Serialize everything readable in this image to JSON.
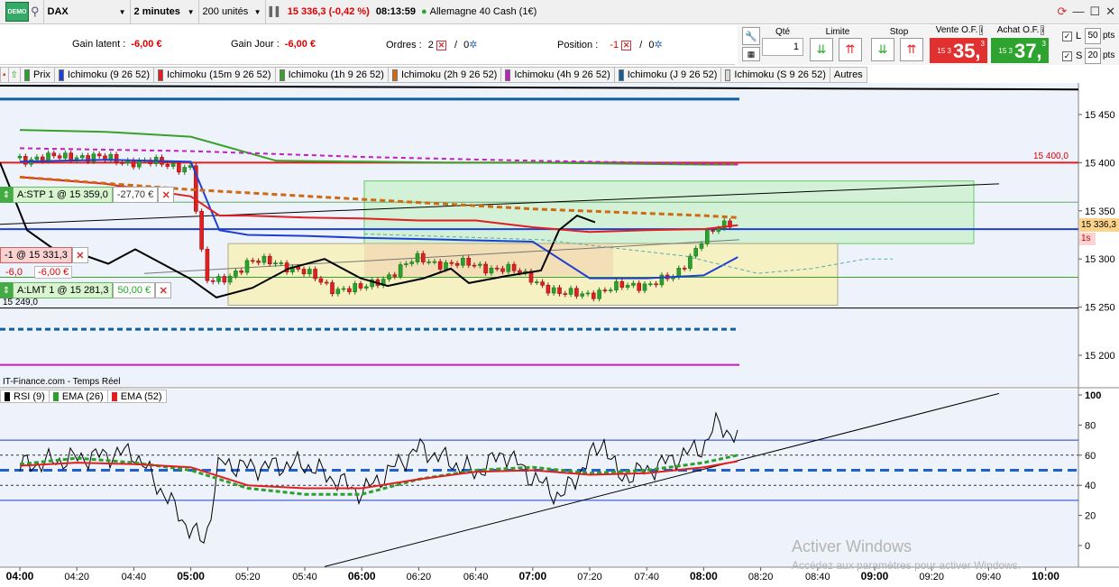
{
  "topbar": {
    "demo_label": "DEMO",
    "instrument": "DAX",
    "timeframe": "2 minutes",
    "units": "200 unités",
    "price": "15 336,3",
    "change": "(-0,42 %)",
    "time": "08:13:59",
    "market": "Allemagne 40 Cash (1€)"
  },
  "info": {
    "gain_latent_label": "Gain latent :",
    "gain_latent_value": "-6,00 €",
    "gain_jour_label": "Gain Jour :",
    "gain_jour_value": "-6,00 €",
    "ordres_label": "Ordres :",
    "ordres_a": "2",
    "ordres_b": "0",
    "position_label": "Position :",
    "position_a": "-1",
    "position_b": "0"
  },
  "order_panel": {
    "qte_label": "Qté",
    "qte_value": "1",
    "limite_label": "Limite",
    "stop_label": "Stop",
    "vente_label": "Vente O.F.",
    "achat_label": "Achat O.F.",
    "vente_prefix": "15 3",
    "vente_big": "35,",
    "vente_sup": "3",
    "achat_prefix": "15 3",
    "achat_big": "37,",
    "achat_sup": "3",
    "l_label": "L",
    "l_value": "50",
    "s_label": "S",
    "s_value": "20",
    "pts": "pts",
    "colors": {
      "sell": "#e03030",
      "buy": "#2fa32f"
    }
  },
  "legend": [
    {
      "label": "Prix",
      "color": "#2ca02c"
    },
    {
      "label": "Ichimoku (9 26 52)",
      "color": "#1f3fd0"
    },
    {
      "label": "Ichimoku (15m 9 26 52)",
      "color": "#e02020"
    },
    {
      "label": "Ichimoku (1h 9 26 52)",
      "color": "#3aa02a"
    },
    {
      "label": "Ichimoku (2h 9 26 52)",
      "color": "#d06a10"
    },
    {
      "label": "Ichimoku (4h 9 26 52)",
      "color": "#c020c0"
    },
    {
      "label": "Ichimoku (J 9 26 52)",
      "color": "#1060a0"
    },
    {
      "label": "Ichimoku (S 9 26 52)",
      "color": "#d8d8d8"
    },
    {
      "label": "Autres",
      "color": ""
    }
  ],
  "tags": {
    "stop": {
      "label": "A:STP  1 @ 15 359,0",
      "pnl": "-27,70 €"
    },
    "position": {
      "label": "-1 @ 15 331,3",
      "pnl_a": "-6,0",
      "pnl_b": "-6,00 €"
    },
    "limit": {
      "label": "A:LMT  1 @ 15 281,3",
      "pnl": "50,00 €"
    },
    "level_low": "15 249,0",
    "level_high": "15 400,0",
    "last_price": "15 336,3",
    "period": "1s"
  },
  "source": "IT-Finance.com - Temps Réel",
  "rsi_legend": [
    {
      "label": "RSI (9)",
      "color": "#000000"
    },
    {
      "label": "EMA (26)",
      "color": "#2ca02c"
    },
    {
      "label": "EMA (52)",
      "color": "#e02020"
    }
  ],
  "chart_data": {
    "type": "line",
    "title": "",
    "price_axis": {
      "ticks": [
        15450,
        15400,
        15350,
        15300,
        15250,
        15200
      ],
      "labels": [
        "15 450",
        "15 400",
        "15 350",
        "15 300",
        "15 250",
        "15 200"
      ],
      "ylim": [
        15180,
        15490
      ]
    },
    "rsi_axis": {
      "ticks": [
        100,
        80,
        60,
        40,
        20,
        0
      ],
      "labels": [
        "100",
        "80",
        "60",
        "40",
        "20",
        "0"
      ],
      "ylim": [
        -15,
        105
      ]
    },
    "x_ticks": [
      "04:00",
      "04:20",
      "04:40",
      "05:00",
      "05:20",
      "05:40",
      "06:00",
      "06:20",
      "06:40",
      "07:00",
      "07:20",
      "07:40",
      "08:00",
      "08:20",
      "08:40",
      "09:00",
      "09:20",
      "09:40",
      "10:00"
    ],
    "x_bold": [
      "04:00",
      "05:00",
      "06:00",
      "07:00",
      "08:00",
      "09:00",
      "10:00"
    ],
    "series": [
      {
        "name": "Prix",
        "x": [
          "04:00",
          "04:10",
          "04:20",
          "04:30",
          "04:40",
          "04:50",
          "05:00",
          "05:05",
          "05:10",
          "05:20",
          "05:30",
          "05:40",
          "05:50",
          "06:00",
          "06:10",
          "06:20",
          "06:30",
          "06:40",
          "06:50",
          "07:00",
          "07:10",
          "07:20",
          "07:30",
          "07:40",
          "07:50",
          "08:00",
          "08:10"
        ],
        "values": [
          15405,
          15404,
          15408,
          15403,
          15402,
          15398,
          15396,
          15275,
          15278,
          15295,
          15298,
          15285,
          15270,
          15268,
          15285,
          15300,
          15295,
          15293,
          15290,
          15280,
          15262,
          15265,
          15270,
          15275,
          15280,
          15325,
          15336
        ]
      },
      {
        "name": "Ichimoku (9 26 52)",
        "x": [
          "04:00",
          "04:30",
          "05:00",
          "05:10",
          "05:20",
          "05:40",
          "06:00",
          "06:30",
          "07:00",
          "07:20",
          "07:40",
          "08:00",
          "08:12"
        ],
        "values": [
          15401,
          15403,
          15401,
          15330,
          15325,
          15324,
          15322,
          15320,
          15318,
          15280,
          15280,
          15283,
          15302
        ]
      },
      {
        "name": "Ichimoku (15m 9 26 52)",
        "x": [
          "04:00",
          "04:30",
          "05:00",
          "05:10",
          "05:20",
          "05:40",
          "06:00",
          "06:20",
          "06:40",
          "07:00",
          "07:20",
          "07:40",
          "08:00",
          "08:12"
        ],
        "values": [
          15385,
          15378,
          15365,
          15345,
          15345,
          15343,
          15342,
          15340,
          15340,
          15333,
          15328,
          15330,
          15331,
          15335
        ]
      },
      {
        "name": "Ichimoku (1h 9 26 52)",
        "x": [
          "04:00",
          "04:30",
          "05:00",
          "05:30",
          "06:00",
          "06:30",
          "07:00",
          "07:30",
          "08:00",
          "08:12"
        ],
        "values": [
          15434,
          15432,
          15427,
          15402,
          15401,
          15400,
          15400,
          15399,
          15398,
          15398
        ]
      },
      {
        "name": "Ichimoku (2h 9 26 52)",
        "x": [
          "04:00",
          "05:00",
          "06:00",
          "07:00",
          "08:00",
          "08:12"
        ],
        "values": [
          15385,
          15372,
          15362,
          15352,
          15345,
          15343
        ]
      },
      {
        "name": "Ichimoku (4h 9 26 52)",
        "x": [
          "04:00",
          "05:00",
          "06:00",
          "07:00",
          "08:00",
          "08:12"
        ],
        "values": [
          15415,
          15412,
          15406,
          15402,
          15399,
          15398
        ]
      },
      {
        "name": "RSI (9)",
        "x": [
          "04:00",
          "04:20",
          "04:40",
          "05:00",
          "05:05",
          "05:10",
          "05:20",
          "05:40",
          "06:00",
          "06:20",
          "06:40",
          "06:50",
          "07:00",
          "07:10",
          "07:20",
          "07:25",
          "07:30",
          "07:40",
          "08:00",
          "08:05",
          "08:12"
        ],
        "values": [
          53,
          58,
          62,
          10,
          2,
          55,
          52,
          54,
          35,
          65,
          48,
          62,
          45,
          32,
          58,
          70,
          45,
          50,
          66,
          82,
          70
        ]
      },
      {
        "name": "EMA (26)",
        "x": [
          "04:00",
          "04:20",
          "04:40",
          "05:00",
          "05:20",
          "05:40",
          "06:00",
          "06:20",
          "06:40",
          "07:00",
          "07:20",
          "07:40",
          "08:00",
          "08:12"
        ],
        "values": [
          54,
          58,
          55,
          50,
          38,
          34,
          34,
          44,
          50,
          52,
          48,
          50,
          55,
          60
        ]
      },
      {
        "name": "EMA (52)",
        "x": [
          "04:00",
          "04:20",
          "04:40",
          "05:00",
          "05:20",
          "05:40",
          "06:00",
          "06:20",
          "06:40",
          "07:00",
          "07:20",
          "07:40",
          "08:00",
          "08:12"
        ],
        "values": [
          53,
          55,
          54,
          52,
          40,
          38,
          38,
          44,
          49,
          50,
          47,
          48,
          52,
          56
        ]
      }
    ],
    "rsi_levels": [
      70,
      60,
      50,
      40,
      30
    ],
    "horizontal_levels": [
      15466,
      15400,
      15359,
      15331,
      15281,
      15249,
      15227,
      15190
    ]
  },
  "watermark": {
    "title": "Activer Windows",
    "subtitle": "Accédez aux paramètres pour activer Windows."
  }
}
